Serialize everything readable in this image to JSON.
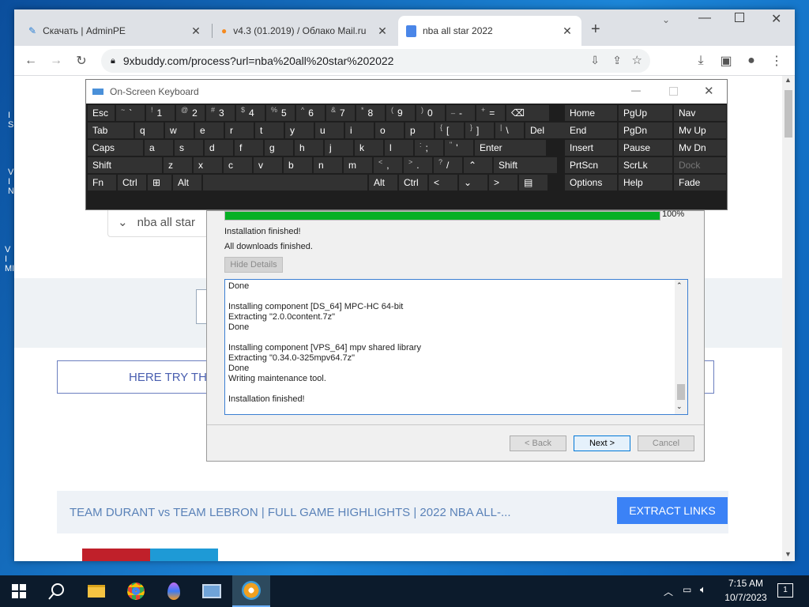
{
  "browser": {
    "tabs": [
      {
        "title": "Скачать | AdminPE",
        "icon": "wrench-icon"
      },
      {
        "title": "v4.3 (01.2019) / Облако Mail.ru",
        "icon": "cloud-icon"
      },
      {
        "title": "nba all star 2022",
        "icon": "doc-icon"
      }
    ],
    "url": "9xbuddy.com/process?url=nba%20all%20star%202022"
  },
  "page": {
    "search_text": "nba all star",
    "try_text": "HERE TRY THI",
    "video_title": "TEAM DURANT vs TEAM LEBRON | FULL GAME HIGHLIGHTS | 2022 NBA ALL-...",
    "extract_label": "EXTRACT LINKS",
    "accent": "#3b82f6"
  },
  "osk": {
    "title": "On-Screen Keyboard",
    "rows": [
      [
        {
          "l": "Esc"
        },
        {
          "s": "~",
          "l": "`"
        },
        {
          "s": "!",
          "l": "1"
        },
        {
          "s": "@",
          "l": "2"
        },
        {
          "s": "#",
          "l": "3"
        },
        {
          "s": "$",
          "l": "4"
        },
        {
          "s": "%",
          "l": "5"
        },
        {
          "s": "^",
          "l": "6"
        },
        {
          "s": "&",
          "l": "7"
        },
        {
          "s": "*",
          "l": "8"
        },
        {
          "s": "(",
          "l": "9"
        },
        {
          "s": ")",
          "l": "0"
        },
        {
          "s": "_",
          "l": "-"
        },
        {
          "s": "+",
          "l": "="
        },
        {
          "l": "⌫"
        }
      ],
      [
        {
          "l": "Tab"
        },
        {
          "l": "q"
        },
        {
          "l": "w"
        },
        {
          "l": "e"
        },
        {
          "l": "r"
        },
        {
          "l": "t"
        },
        {
          "l": "y"
        },
        {
          "l": "u"
        },
        {
          "l": "i"
        },
        {
          "l": "o"
        },
        {
          "l": "p"
        },
        {
          "s": "{",
          "l": "["
        },
        {
          "s": "}",
          "l": "]"
        },
        {
          "s": "|",
          "l": "\\"
        },
        {
          "l": "Del"
        }
      ],
      [
        {
          "l": "Caps"
        },
        {
          "l": "a"
        },
        {
          "l": "s"
        },
        {
          "l": "d"
        },
        {
          "l": "f"
        },
        {
          "l": "g"
        },
        {
          "l": "h"
        },
        {
          "l": "j"
        },
        {
          "l": "k"
        },
        {
          "l": "l"
        },
        {
          "s": ":",
          "l": ";"
        },
        {
          "s": "\"",
          "l": "'"
        },
        {
          "l": "Enter"
        }
      ],
      [
        {
          "l": "Shift"
        },
        {
          "l": "z"
        },
        {
          "l": "x"
        },
        {
          "l": "c"
        },
        {
          "l": "v"
        },
        {
          "l": "b"
        },
        {
          "l": "n"
        },
        {
          "l": "m"
        },
        {
          "s": "<",
          "l": ","
        },
        {
          "s": ">",
          "l": "."
        },
        {
          "s": "?",
          "l": "/"
        },
        {
          "l": "⌃"
        },
        {
          "l": "Shift"
        }
      ],
      [
        {
          "l": "Fn"
        },
        {
          "l": "Ctrl"
        },
        {
          "l": "⊞"
        },
        {
          "l": "Alt"
        },
        {
          "l": ""
        },
        {
          "l": "Alt"
        },
        {
          "l": "Ctrl"
        },
        {
          "l": "<"
        },
        {
          "l": "⌄"
        },
        {
          "l": ">"
        },
        {
          "l": "▤"
        }
      ]
    ],
    "nav": [
      [
        "Home",
        "PgUp",
        "Nav"
      ],
      [
        "End",
        "PgDn",
        "Mv Up"
      ],
      [
        "Insert",
        "Pause",
        "Mv Dn"
      ],
      [
        "PrtScn",
        "ScrLk",
        "Dock"
      ],
      [
        "Options",
        "Help",
        "Fade"
      ]
    ]
  },
  "installer": {
    "progress_label": "100%",
    "progress": 1.0,
    "status1": "Installation finished!",
    "status2": "All downloads finished.",
    "hide_details": "Hide Details",
    "log": [
      "Done",
      "",
      "Installing component [DS_64] MPC-HC 64-bit",
      "Extracting \"2.0.0content.7z\"",
      "Done",
      "",
      "Installing component [VPS_64] mpv shared library",
      "Extracting \"0.34.0-325mpv64.7z\"",
      "Done",
      "Writing maintenance tool.",
      "",
      "Installation finished!"
    ],
    "back": "< Back",
    "next": "Next >",
    "cancel": "Cancel"
  },
  "taskbar": {
    "time": "7:15 AM",
    "date": "10/7/2023",
    "notif_count": "1"
  }
}
